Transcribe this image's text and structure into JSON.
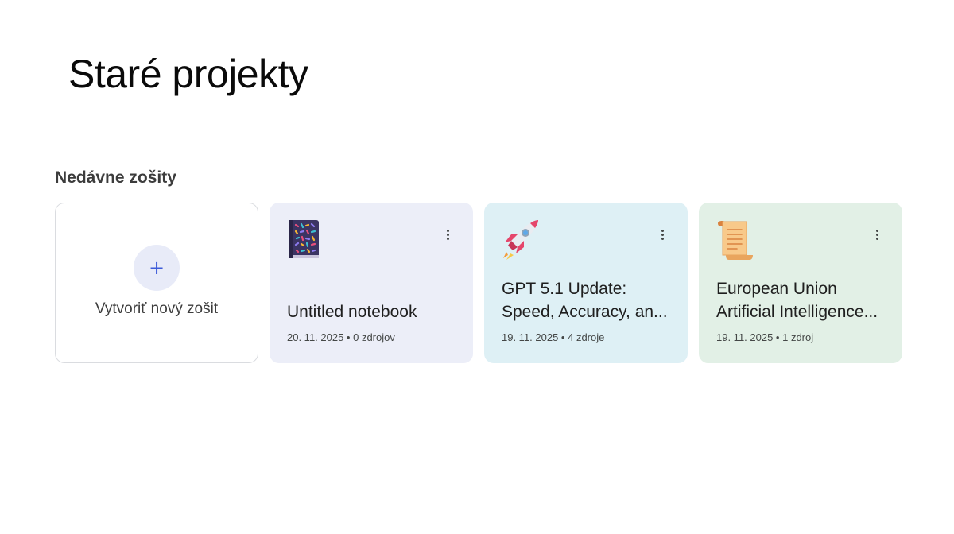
{
  "page": {
    "title": "Staré projekty"
  },
  "section": {
    "title": "Nedávne zošity"
  },
  "new_notebook": {
    "label": "Vytvoriť nový zošit",
    "plus": "+"
  },
  "notebooks": [
    {
      "icon": "book-icon",
      "title": "Untitled notebook",
      "meta": "20. 11. 2025 • 0 zdrojov",
      "background": "#eceef8"
    },
    {
      "icon": "rocket-icon",
      "title": "GPT 5.1 Update: Speed, Accuracy, an...",
      "meta": "19. 11. 2025 • 4 zdroje",
      "background": "#def0f5"
    },
    {
      "icon": "scroll-icon",
      "title": "European Union Artificial Intelligence...",
      "meta": "19. 11. 2025 • 1 zdroj",
      "background": "#e2f0e6"
    }
  ],
  "colors": {
    "accent": "#3d5bd9",
    "plus_bg": "#e8ebf8"
  }
}
